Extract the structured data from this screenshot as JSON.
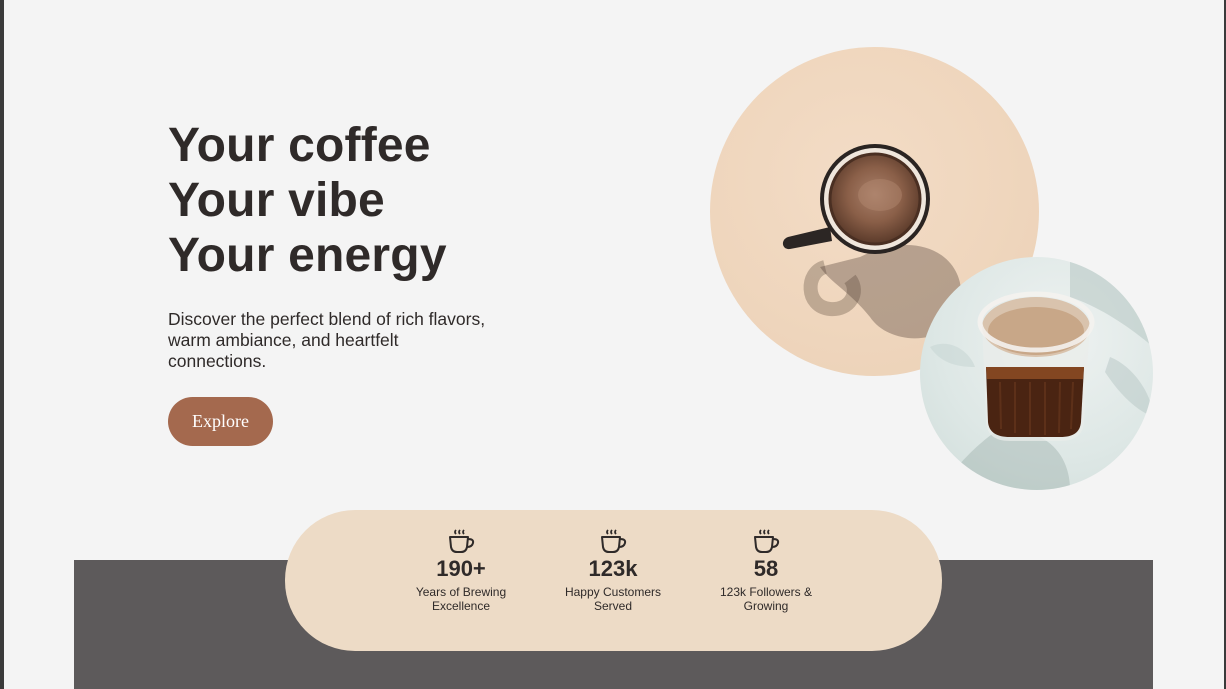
{
  "hero": {
    "headline_lines": [
      "Your coffee",
      "Your vibe",
      "Your energy"
    ],
    "subtitle": "Discover the perfect blend of rich flavors, warm ambiance, and heartfelt connections.",
    "cta_label": "Explore"
  },
  "stats": [
    {
      "icon": "coffee-cup-icon",
      "value": "190+",
      "label": "Years of Brewing Excellence"
    },
    {
      "icon": "coffee-cup-icon",
      "value": "123k",
      "label": "Happy Customers Served"
    },
    {
      "icon": "coffee-cup-icon",
      "value": "58",
      "label": "123k Followers & Growing"
    }
  ],
  "images": {
    "large": "coffee-mug-photo",
    "small": "iced-coffee-glass-photo"
  },
  "colors": {
    "background": "#f4f4f4",
    "text": "#2f2a29",
    "cta": "#a4694e",
    "stats_pill": "#eddbc6",
    "band": "#5d5a5b"
  }
}
